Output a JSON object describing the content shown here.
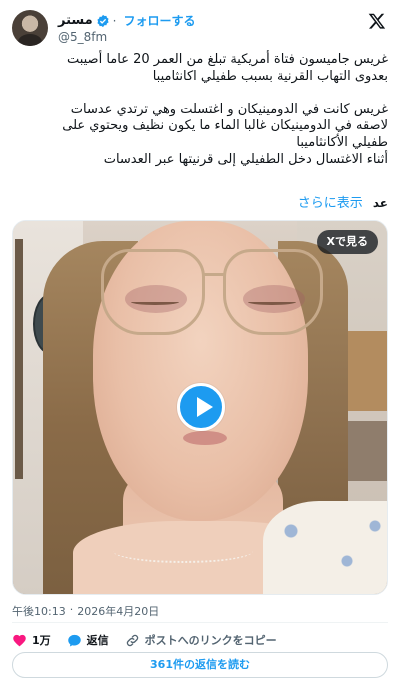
{
  "author": {
    "display_name": "مستر",
    "handle": "@5_8fm",
    "verified": true,
    "follow_label": "フォローする"
  },
  "tweet": {
    "text": "غريس جاميسون فتاة أمريكية تبلغ من العمر 20 عاما أصيبت\nبعدوى التهاب القرنية بسبب طفيلي اكانثاميبا\n\nغريس كانت في الدومينيكان و اغتسلت وهي ترتدي عدسات\nلاصقه في الدومينيكان غالبا الماء ما يكون نظيف ويحتوي على\nطفيلي الأكانثاميبا\nأثناء الاغتسال دخل الطفيلي إلى قرنيتها عبر العدسات",
    "translate_link": "さらに表示",
    "translate_language": "عد"
  },
  "media": {
    "view_on_x_label": "Xで見る",
    "type": "video"
  },
  "meta": {
    "time": "午後10:13",
    "separator": "·",
    "date": "2026年4月20日"
  },
  "actions": {
    "likes": "1万",
    "reply_label": "返信",
    "copy_link_label": "ポストへのリンクをコピー"
  },
  "read_replies_label": "361件の返信を読む",
  "colors": {
    "accent": "#1d9bf0",
    "like": "#f91880",
    "text": "#0f1419",
    "muted": "#536471"
  },
  "icons": [
    "x-logo-icon",
    "verified-badge-icon",
    "play-icon",
    "heart-icon",
    "reply-icon",
    "link-icon"
  ]
}
